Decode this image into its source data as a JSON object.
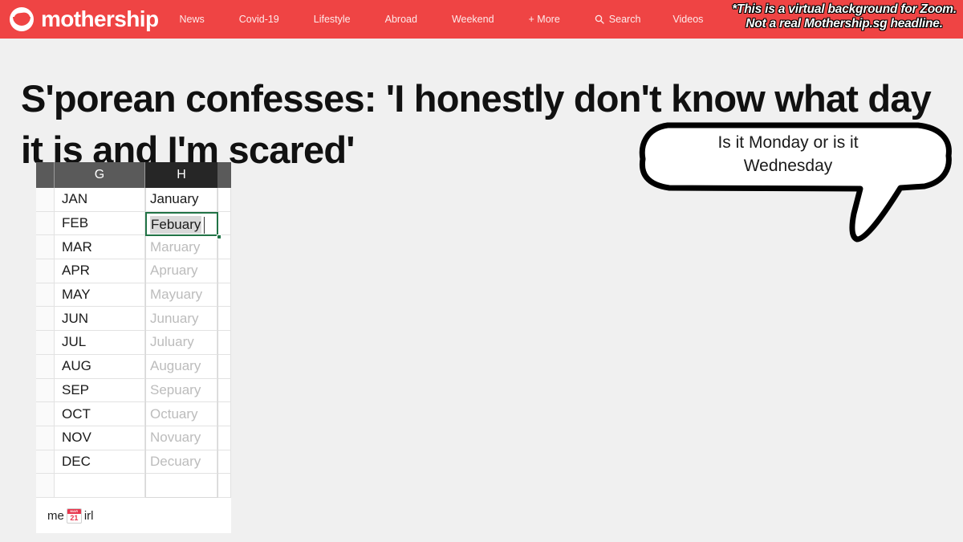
{
  "nav": {
    "brand": "mothership",
    "items": [
      {
        "label": "News",
        "icon": null
      },
      {
        "label": "Covid-19",
        "icon": null
      },
      {
        "label": "Lifestyle",
        "icon": null
      },
      {
        "label": "Abroad",
        "icon": null
      },
      {
        "label": "Weekend",
        "icon": null
      },
      {
        "label": "+ More",
        "icon": null
      },
      {
        "label": "Search",
        "icon": "search-icon"
      },
      {
        "label": "Videos",
        "icon": null
      }
    ],
    "bar_color": "#ef4444"
  },
  "disclaimer": {
    "line1": "*This is a virtual background for Zoom.",
    "line2": "Not a real Mothership.sg headline."
  },
  "headline": {
    "text": "S'porean confesses: 'I honestly don't know what day it is and I'm scared'"
  },
  "spreadsheet": {
    "column_headers": [
      "",
      "G",
      "H"
    ],
    "selected_column": "H",
    "selection_color": "#217346",
    "editing_cell": {
      "value": "Febuary",
      "column": "H",
      "row_index": 2
    },
    "rows": [
      {
        "g": "JAN",
        "h": "January",
        "ghost": false
      },
      {
        "g": "FEB",
        "h": "Febuary",
        "ghost": false
      },
      {
        "g": "MAR",
        "h": "Maruary",
        "ghost": true
      },
      {
        "g": "APR",
        "h": "Apruary",
        "ghost": true
      },
      {
        "g": "MAY",
        "h": "Mayuary",
        "ghost": true
      },
      {
        "g": "JUN",
        "h": "Junuary",
        "ghost": true
      },
      {
        "g": "JUL",
        "h": "Juluary",
        "ghost": true
      },
      {
        "g": "AUG",
        "h": "Auguary",
        "ghost": true
      },
      {
        "g": "SEP",
        "h": "Sepuary",
        "ghost": true
      },
      {
        "g": "OCT",
        "h": "Octuary",
        "ghost": true
      },
      {
        "g": "NOV",
        "h": "Novuary",
        "ghost": true
      },
      {
        "g": "DEC",
        "h": "Decuary",
        "ghost": true
      },
      {
        "g": "",
        "h": "",
        "ghost": false
      }
    ],
    "caption": {
      "before": "me",
      "emoji_month": "MAR",
      "emoji_day": "21",
      "after": "irl"
    }
  },
  "speech_bubble": {
    "line1": "Is it Monday or is it",
    "line2": "Wednesday"
  }
}
